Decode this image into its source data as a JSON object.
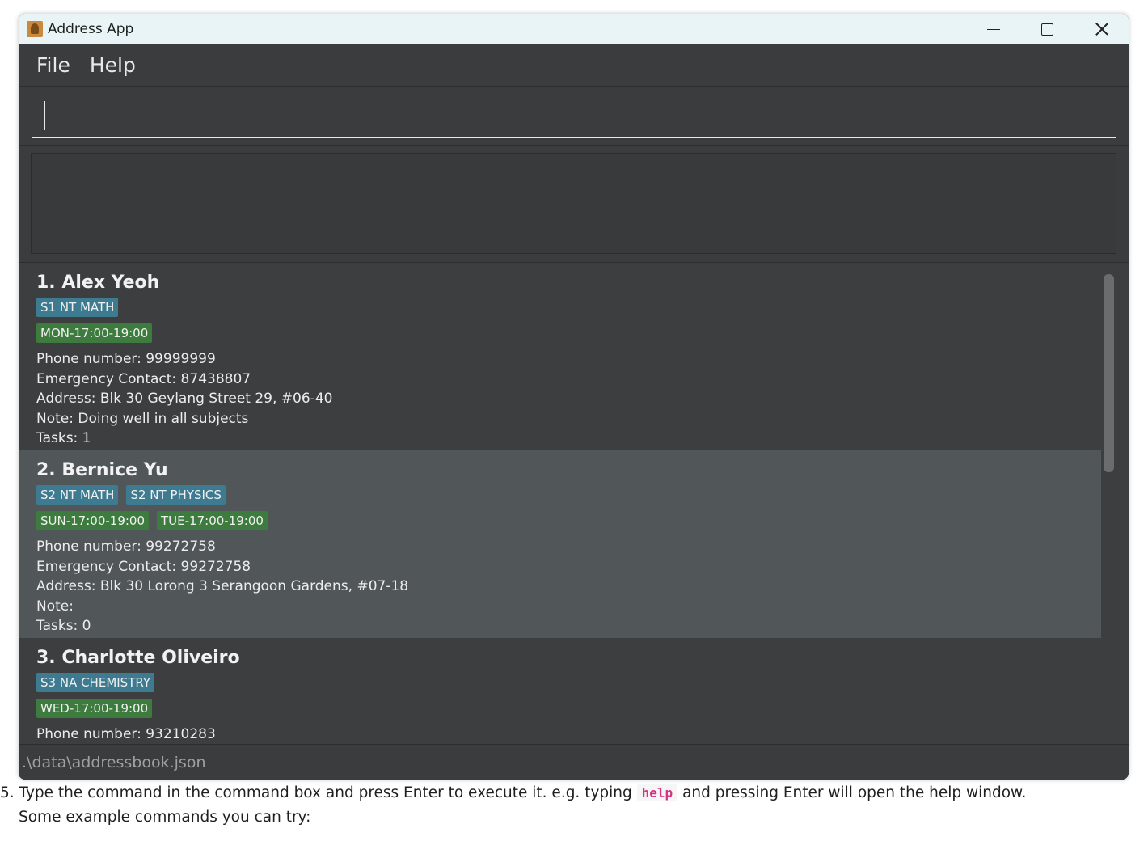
{
  "window": {
    "title": "Address App",
    "app_icon": "address-book-icon"
  },
  "menu": {
    "file": "File",
    "help": "Help"
  },
  "command_box": {
    "value": "",
    "placeholder": ""
  },
  "result_display": {
    "text": ""
  },
  "persons": [
    {
      "name": "1. Alex Yeoh",
      "subjects": [
        "S1 NT MATH"
      ],
      "slots": [
        "MON-17:00-19:00"
      ],
      "phone": "Phone number: 99999999",
      "emergency": "Emergency Contact: 87438807",
      "address": "Address: Blk 30 Geylang Street 29, #06-40",
      "note": "Note: Doing well in all subjects",
      "tasks": "Tasks: 1"
    },
    {
      "name": "2. Bernice Yu",
      "subjects": [
        "S2 NT MATH",
        "S2 NT PHYSICS"
      ],
      "slots": [
        "SUN-17:00-19:00",
        "TUE-17:00-19:00"
      ],
      "phone": "Phone number: 99272758",
      "emergency": "Emergency Contact: 99272758",
      "address": "Address: Blk 30 Lorong 3 Serangoon Gardens, #07-18",
      "note": "Note:",
      "tasks": "Tasks: 0"
    },
    {
      "name": "3. Charlotte Oliveiro",
      "subjects": [
        "S3 NA CHEMISTRY"
      ],
      "slots": [
        "WED-17:00-19:00"
      ],
      "phone": "Phone number: 93210283",
      "emergency": "",
      "address": "",
      "note": "",
      "tasks": ""
    }
  ],
  "status_bar": {
    "path": ".\\data\\addressbook.json"
  },
  "doc": {
    "line1_before": "5. Type the command in the command box and press Enter to execute it. e.g. typing",
    "line1_code": "help",
    "line1_after": "and pressing Enter will open the help window.",
    "line2": "Some example commands you can try:"
  },
  "colors": {
    "subject_tag": "#3e7b91",
    "slot_tag": "#3e7b3e",
    "selected_card": "#515658",
    "background": "#3c3e40"
  }
}
